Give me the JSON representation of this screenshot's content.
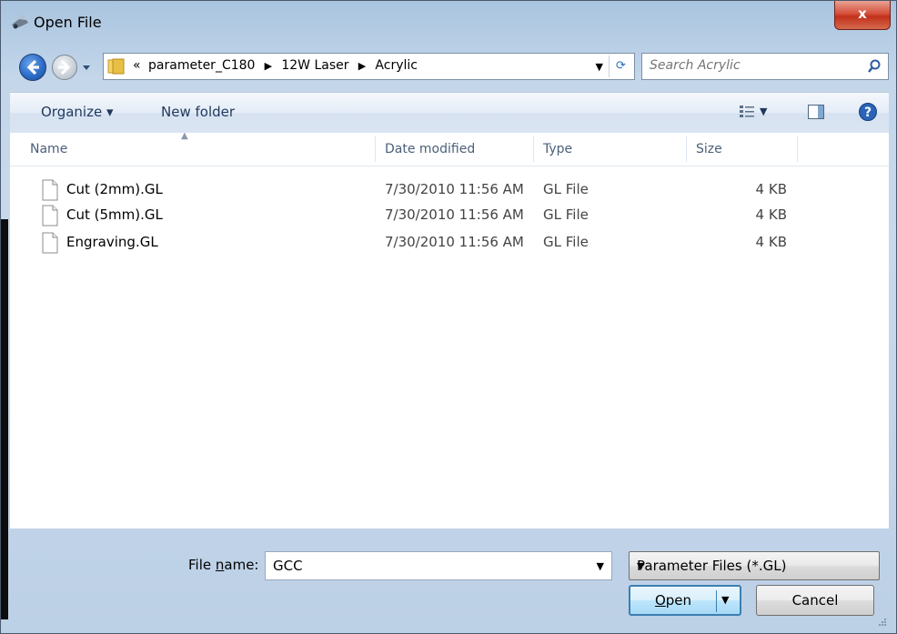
{
  "window": {
    "title": "Open File",
    "close_label": "x"
  },
  "navigation": {
    "breadcrumb_prefix": "«",
    "path": [
      "parameter_C180",
      "12W Laser",
      "Acrylic"
    ],
    "search_placeholder": "Search Acrylic"
  },
  "toolbar": {
    "organize_label": "Organize ▾",
    "new_folder_label": "New folder"
  },
  "columns": {
    "name": "Name",
    "date": "Date modified",
    "type": "Type",
    "size": "Size"
  },
  "files": [
    {
      "name": "Cut (2mm).GL",
      "date": "7/30/2010 11:56 AM",
      "type": "GL File",
      "size": "4 KB"
    },
    {
      "name": "Cut (5mm).GL",
      "date": "7/30/2010 11:56 AM",
      "type": "GL File",
      "size": "4 KB"
    },
    {
      "name": "Engraving.GL",
      "date": "7/30/2010 11:56 AM",
      "type": "GL File",
      "size": "4 KB"
    }
  ],
  "bottom": {
    "file_name_label_pre": "File ",
    "file_name_label_acc": "n",
    "file_name_label_post": "ame:",
    "file_name_value": "GCC",
    "filter_value": "Parameter Files (*.GL)",
    "open_label_acc": "O",
    "open_label_rest": "pen",
    "cancel_label": "Cancel"
  },
  "colors": {
    "accent": "#3c7fb1",
    "title_close": "#c1301b"
  }
}
